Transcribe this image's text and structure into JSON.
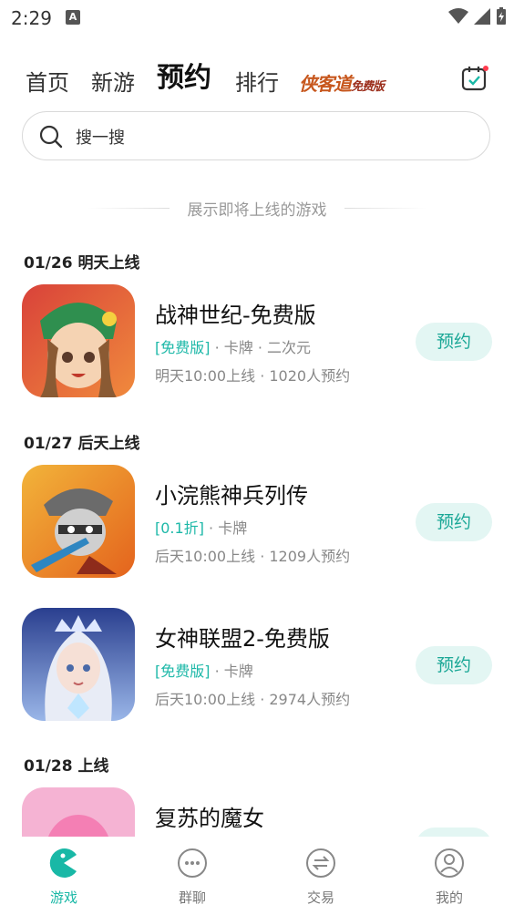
{
  "status_bar": {
    "time": "2:29",
    "notif_letter": "A"
  },
  "tabs": {
    "home": "首页",
    "new": "新游",
    "reserve": "预约",
    "rank": "排行",
    "brand": "侠客道",
    "brand_sub": "免费版"
  },
  "search": {
    "placeholder": "搜一搜"
  },
  "divider_text": "展示即将上线的游戏",
  "sections": [
    {
      "title": "01/26 明天上线"
    },
    {
      "title": "01/27 后天上线"
    },
    {
      "title": "01/28 上线"
    }
  ],
  "games": [
    {
      "name": "战神世纪-免费版",
      "tag": "[免费版]",
      "tag_rest": " · 卡牌 · 二次元",
      "meta": "明天10:00上线 · 1020人预约",
      "button": "预约"
    },
    {
      "name": "小浣熊神兵列传",
      "tag": "[0.1折]",
      "tag_rest": " · 卡牌",
      "meta": "后天10:00上线 · 1209人预约",
      "button": "预约"
    },
    {
      "name": "女神联盟2-免费版",
      "tag": "[免费版]",
      "tag_rest": " · 卡牌",
      "meta": "后天10:00上线 · 2974人预约",
      "button": "预约"
    },
    {
      "name": "复苏的魔女"
    }
  ],
  "bottom_nav": [
    {
      "label": "游戏"
    },
    {
      "label": "群聊"
    },
    {
      "label": "交易"
    },
    {
      "label": "我的"
    }
  ],
  "colors": {
    "accent": "#19b8a6",
    "button_bg": "#e3f6f3",
    "brand": "#c7571d"
  }
}
